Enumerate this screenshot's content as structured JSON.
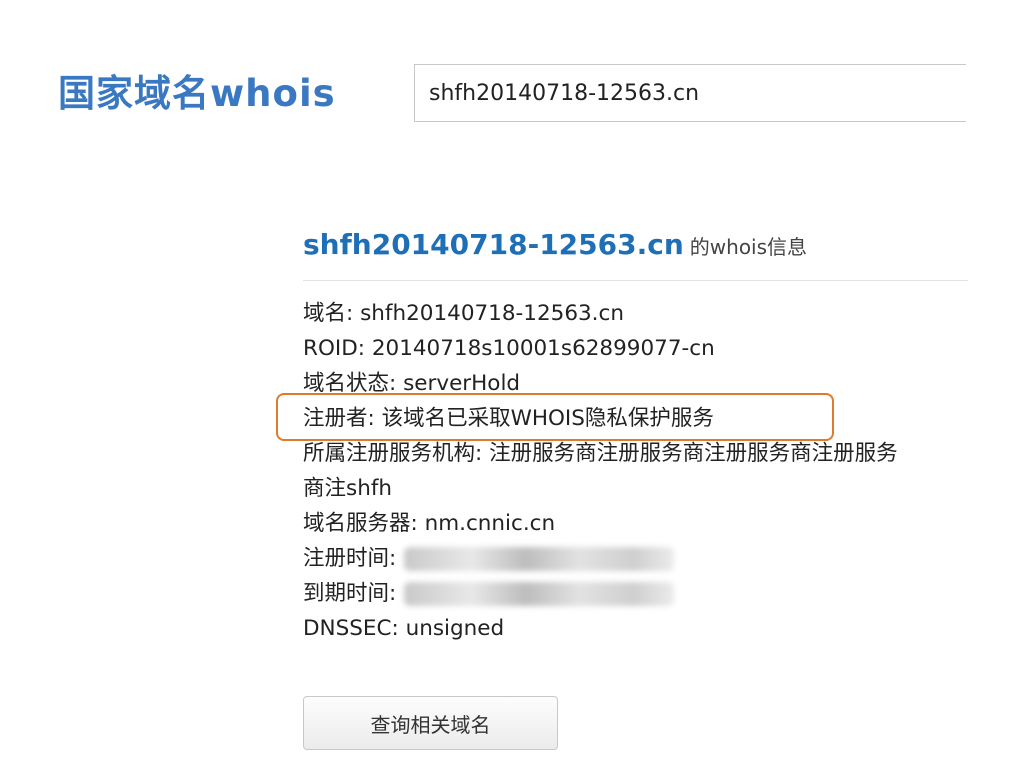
{
  "header": {
    "logo_text": "国家域名whois"
  },
  "search": {
    "value": "shfh20140718-12563.cn"
  },
  "result": {
    "domain": "shfh20140718-12563.cn",
    "suffix": "的whois信息"
  },
  "info": {
    "rows": [
      "域名: shfh20140718-12563.cn",
      "ROID: 20140718s10001s62899077-cn",
      "域名状态: serverHold",
      "注册者: 该域名已采取WHOIS隐私保护服务",
      "所属注册服务机构: 注册服务商注册服务商注册服务商注册服务",
      "商注shfh",
      "域名服务器: nm.cnnic.cn",
      "注册时间:",
      "到期时间:",
      "DNSSEC: unsigned"
    ]
  },
  "actions": {
    "related_button_label": "查询相关域名"
  },
  "colors": {
    "logo": "#3a78c2",
    "domain_title": "#1f6fb6",
    "highlight_border": "#e07b2c"
  }
}
